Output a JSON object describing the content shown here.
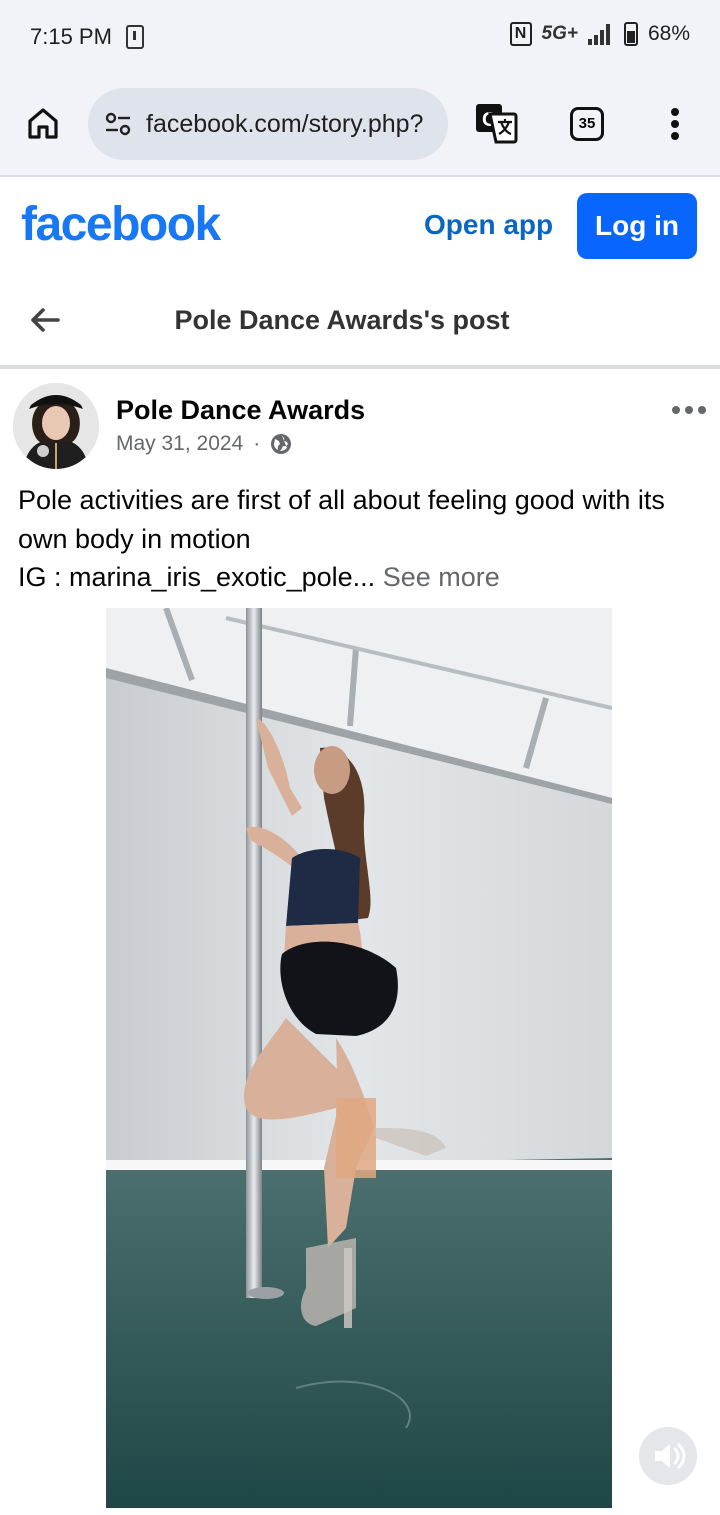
{
  "status_bar": {
    "time": "7:15 PM",
    "network": "5G+",
    "battery": "68%"
  },
  "browser": {
    "url": "facebook.com/story.php?",
    "tab_count": "35"
  },
  "facebook": {
    "logo": "facebook",
    "open_app": "Open app",
    "login": "Log in"
  },
  "page_header": {
    "title": "Pole Dance Awards's post"
  },
  "post": {
    "author": "Pole Dance Awards",
    "date": "May 31, 2024",
    "separator": "·",
    "line1": "Pole activities are first of all about feeling good with its own body in motion",
    "line2": "IG : marina_iris_exotic_pole...",
    "see_more": "See more"
  },
  "colors": {
    "brand": "#1877f2",
    "button": "#0866ff",
    "secondary_text": "#65676b"
  }
}
